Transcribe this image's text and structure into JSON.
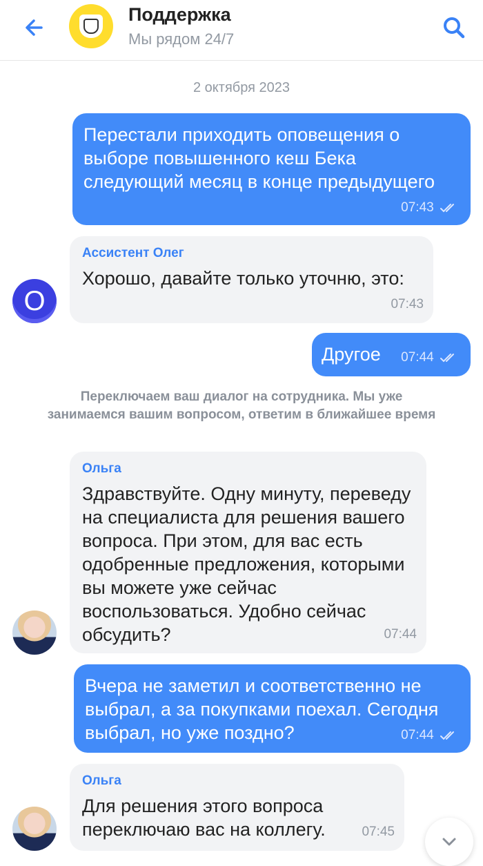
{
  "header": {
    "title": "Поддержка",
    "subtitle": "Мы рядом 24/7",
    "back_icon": "arrow-left-icon",
    "search_icon": "search-icon",
    "accent_color": "#3a82f6",
    "logo_color": "#ffdd2d"
  },
  "chat": {
    "date": "2 октября 2023",
    "messages": [
      {
        "direction": "out",
        "text": "Перестали приходить оповещения о выборе повышенного кеш Бека следующий месяц в конце предыдущего",
        "time": "07:43",
        "status": "read"
      },
      {
        "direction": "in",
        "sender": "Ассистент Олег",
        "avatar": "О",
        "text": "Хорошо, давайте только уточню, это:",
        "time": "07:43"
      },
      {
        "direction": "out",
        "text": "Другое",
        "time": "07:44",
        "status": "read"
      },
      {
        "direction": "system",
        "text": "Переключаем ваш диалог на сотрудника. Мы уже занимаемся вашим вопросом, ответим в ближайшее время"
      },
      {
        "direction": "in",
        "sender": "Ольга",
        "text": "Здравствуйте. Одну минуту, переведу на специалиста для решения вашего вопроса. При этом, для вас есть одобренные предложения, которыми вы можете уже сейчас воспользоваться. Удобно сейчас обсудить?",
        "time": "07:44"
      },
      {
        "direction": "out",
        "text": "Вчера не заметил и соответственно не выбрал, а за покупками поехал. Сегодня выбрал, но уже поздно?",
        "time": "07:44",
        "status": "read"
      },
      {
        "direction": "in",
        "sender": "Ольга",
        "text": "Для решения этого вопроса переключаю вас на коллегу.",
        "time": "07:45"
      }
    ],
    "bubble_out_color": "#428bf9",
    "bubble_in_color": "#f2f3f5",
    "scroll_down_icon": "chevron-down-icon"
  }
}
